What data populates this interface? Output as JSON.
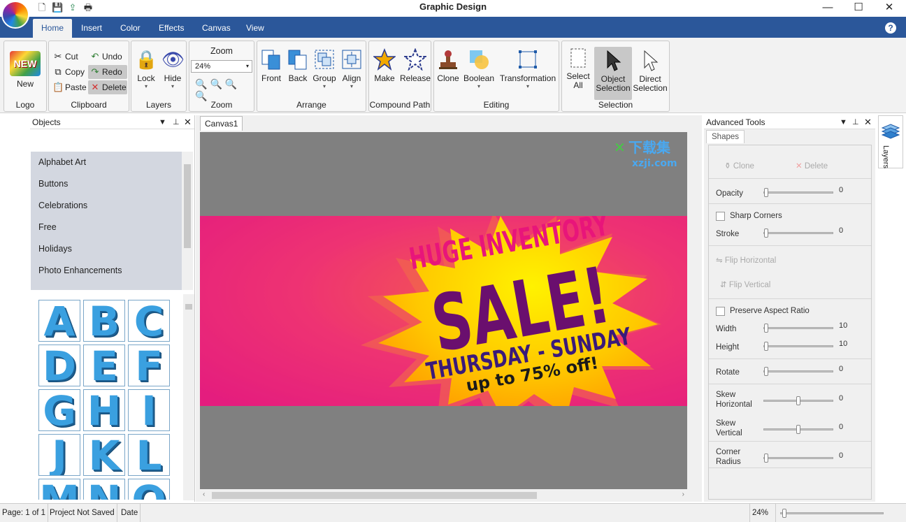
{
  "window": {
    "title": "Graphic Design",
    "minimize": "—",
    "maximize": "☐",
    "close": "✕"
  },
  "tabs": [
    "Home",
    "Insert",
    "Color",
    "Effects",
    "Canvas",
    "View"
  ],
  "help": "?",
  "ribbon": {
    "logo": {
      "new_label": "New",
      "group": "Logo",
      "icon_text": "NEW"
    },
    "clipboard": {
      "cut": "Cut",
      "copy": "Copy",
      "paste": "Paste",
      "undo": "Undo",
      "redo": "Redo",
      "delete": "Delete",
      "group": "Clipboard"
    },
    "layers": {
      "lock": "Lock",
      "hide": "Hide",
      "group": "Layers"
    },
    "zoom": {
      "label": "Zoom",
      "value": "24%",
      "group": "Zoom"
    },
    "arrange": {
      "front": "Front",
      "back": "Back",
      "group_btn": "Group",
      "align": "Align",
      "group": "Arrange"
    },
    "compound": {
      "make": "Make",
      "release": "Release",
      "group": "Compound Path"
    },
    "editing": {
      "clone": "Clone",
      "boolean": "Boolean",
      "transformation": "Transformation",
      "group": "Editing"
    },
    "selection": {
      "select_all_1": "Select",
      "select_all_2": "All",
      "object_1": "Object",
      "object_2": "Selection",
      "direct_1": "Direct",
      "direct_2": "Selection",
      "group": "Selection"
    }
  },
  "objects_panel": {
    "title": "Objects",
    "categories": [
      "Alphabet Art",
      "Buttons",
      "Celebrations",
      "Free",
      "Holidays",
      "Photo Enhancements"
    ],
    "letters": [
      "A",
      "B",
      "C",
      "D",
      "E",
      "F",
      "G",
      "H",
      "I",
      "J",
      "K",
      "L",
      "M",
      "N",
      "O"
    ]
  },
  "canvas": {
    "tab": "Canvas1",
    "banner": {
      "line1": "HUGE INVENTORY",
      "line2": "SALE!",
      "line3": "THURSDAY - SUNDAY",
      "line4": "up to 75% off!"
    }
  },
  "advanced_tools": {
    "title": "Advanced Tools",
    "tab": "Shapes",
    "clone": "Clone",
    "delete": "Delete",
    "opacity": {
      "label": "Opacity",
      "value": "0"
    },
    "sharp_corners": "Sharp Corners",
    "stroke": {
      "label": "Stroke",
      "value": "0"
    },
    "flip_horizontal": "Flip Horizontal",
    "flip_vertical": "Flip Vertical",
    "preserve_aspect": "Preserve Aspect Ratio",
    "width": {
      "label": "Width",
      "value": "10"
    },
    "height": {
      "label": "Height",
      "value": "10"
    },
    "rotate": {
      "label": "Rotate",
      "value": "0"
    },
    "skew_h": {
      "label1": "Skew",
      "label2": "Horizontal",
      "value": "0"
    },
    "skew_v": {
      "label1": "Skew",
      "label2": "Vertical",
      "value": "0"
    },
    "corner": {
      "label1": "Corner",
      "label2": "Radius",
      "value": "0"
    }
  },
  "layers_tab": "Layers",
  "watermark": {
    "cn": "下载集",
    "url": "xzji.com"
  },
  "status": {
    "page": "Page: 1 of 1",
    "saved": "Project Not Saved",
    "date": "Date",
    "zoom": "24%"
  }
}
